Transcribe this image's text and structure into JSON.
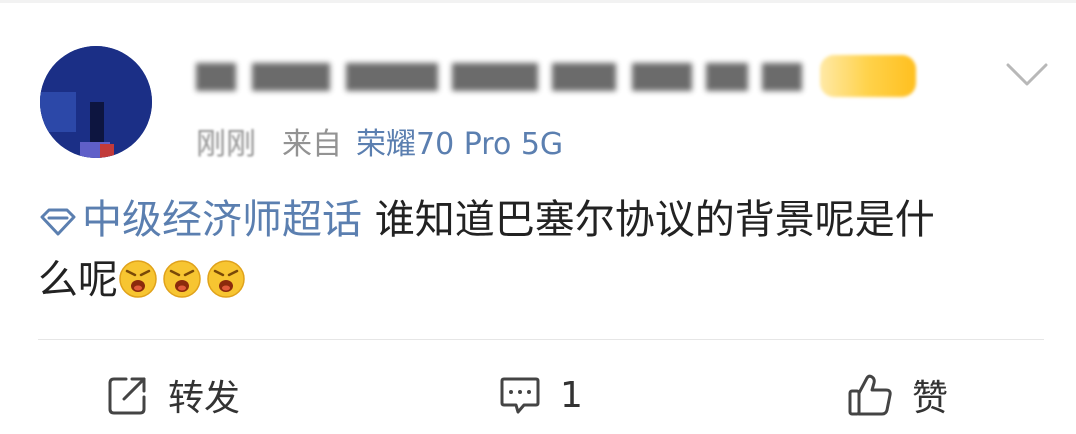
{
  "post": {
    "time": "刚刚",
    "from_label": "来自",
    "device": "荣耀70 Pro 5G",
    "topic": "中级经济师超话",
    "text_line1": "谁知道巴塞尔协议的背景呢是什",
    "text_line2": "么呢",
    "emojis": [
      "angry-face-emoji",
      "angry-face-emoji",
      "angry-face-emoji"
    ]
  },
  "actions": {
    "repost_label": "转发",
    "comment_count": "1",
    "like_label": "赞"
  },
  "colors": {
    "link": "#5b7fb0",
    "text": "#222222",
    "meta": "#939393",
    "divider": "#e6e6e6"
  },
  "icons": {
    "repost": "share-box-icon",
    "comment": "comment-bubble-icon",
    "like": "thumbs-up-icon",
    "more": "chevron-down-icon",
    "topic": "diamond-topic-icon"
  }
}
